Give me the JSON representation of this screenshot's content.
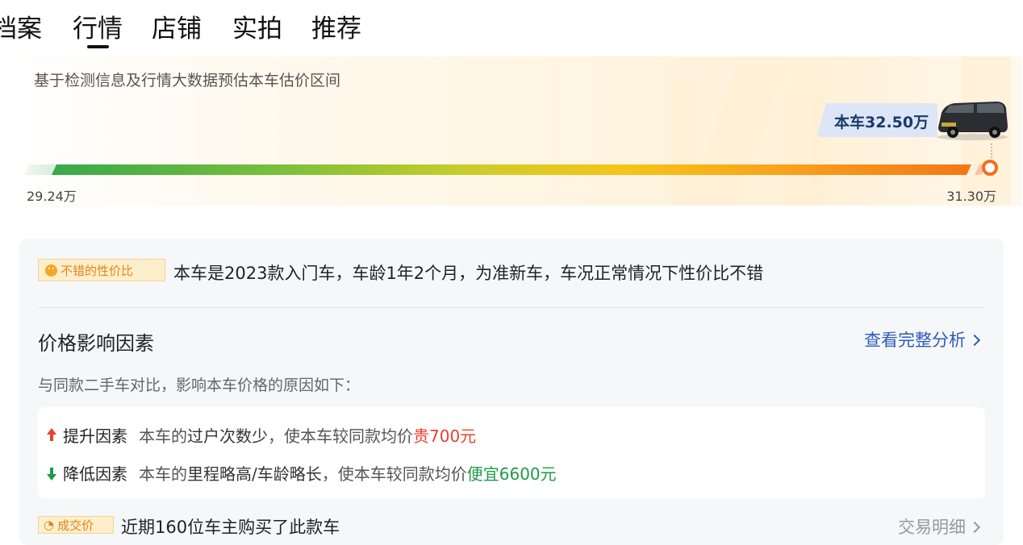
{
  "tabs": [
    {
      "label": "档案"
    },
    {
      "label": "行情"
    },
    {
      "label": "店铺"
    },
    {
      "label": "实拍"
    },
    {
      "label": "推荐"
    }
  ],
  "active_tab": "行情",
  "estimate": {
    "subtitle": "基于检测信息及行情大数据预估本车估价区间",
    "this_car_price": "本车32.50万",
    "range_low": "29.24万",
    "range_high": "31.30万"
  },
  "value": {
    "badge": "不错的性价比",
    "description": "本车是2023款入门车，车龄1年2个月，为准新车，车况正常情况下性价比不错"
  },
  "factors": {
    "title": "价格影响因素",
    "view_link": "查看完整分析",
    "description": "与同款二手车对比，影响本车价格的原因如下：",
    "up": {
      "label": "提升因素",
      "text_prefix": "本车的",
      "text_key": "过户次数少",
      "text_mid": "，使本车较同款均价",
      "value": "贵700元"
    },
    "down": {
      "label": "降低因素",
      "text_prefix": "本车的",
      "text_key": "里程略高/车龄略长",
      "text_mid": "，使本车较同款均价",
      "value": "便宜6600元"
    }
  },
  "deal": {
    "badge": "成交价",
    "text": "近期160位车主购买了此款车",
    "link": "交易明细"
  },
  "colors": {
    "accent_blue": "#2f5bb8",
    "up_red": "#e8412f",
    "down_green": "#1e9a4a",
    "badge_orange": "#e8831a",
    "marker_orange": "#f36f1f"
  }
}
